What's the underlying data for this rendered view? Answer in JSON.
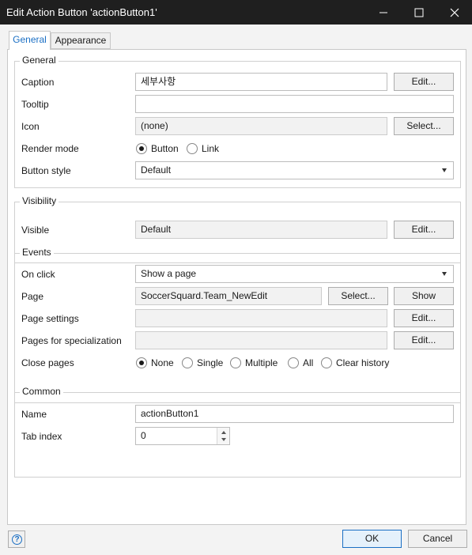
{
  "window": {
    "title": "Edit Action Button 'actionButton1'",
    "minimize_icon": "minimize-icon",
    "maximize_icon": "maximize-icon",
    "close_icon": "close-icon"
  },
  "tabs": [
    {
      "label": "General",
      "active": true
    },
    {
      "label": "Appearance",
      "active": false
    }
  ],
  "general": {
    "title": "General",
    "caption": {
      "label": "Caption",
      "value": "세부사항",
      "button": "Edit..."
    },
    "tooltip": {
      "label": "Tooltip",
      "value": ""
    },
    "icon": {
      "label": "Icon",
      "value": "(none)",
      "button": "Select..."
    },
    "render_mode": {
      "label": "Render mode",
      "options": [
        "Button",
        "Link"
      ],
      "selected": "Button"
    },
    "button_style": {
      "label": "Button style",
      "value": "Default"
    }
  },
  "visibility": {
    "title": "Visibility",
    "visible": {
      "label": "Visible",
      "value": "Default",
      "button": "Edit..."
    }
  },
  "events": {
    "title": "Events",
    "on_click": {
      "label": "On click",
      "value": "Show a page"
    },
    "page": {
      "label": "Page",
      "value": "SoccerSquard.Team_NewEdit",
      "select_button": "Select...",
      "show_button": "Show"
    },
    "page_settings": {
      "label": "Page settings",
      "value": "",
      "button": "Edit..."
    },
    "pages_for_specialization": {
      "label": "Pages for specialization",
      "value": "",
      "button": "Edit..."
    },
    "close_pages": {
      "label": "Close pages",
      "options": [
        "None",
        "Single",
        "Multiple",
        "All",
        "Clear history"
      ],
      "selected": "None"
    }
  },
  "common": {
    "title": "Common",
    "name": {
      "label": "Name",
      "value": "actionButton1"
    },
    "tab_index": {
      "label": "Tab index",
      "value": "0"
    }
  },
  "footer": {
    "help_icon": "help-icon",
    "ok": "OK",
    "cancel": "Cancel"
  },
  "colors": {
    "accent": "#1a6fc4",
    "titlebar": "#1f1f1f"
  }
}
